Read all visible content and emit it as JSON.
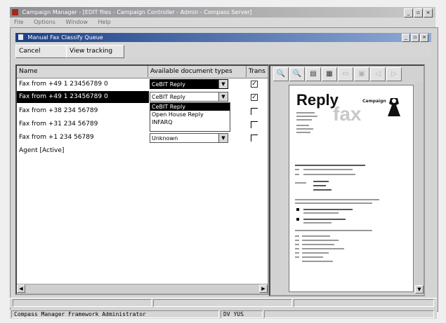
{
  "window": {
    "title": "Campaign Manager - [EDIT files - Campaign Controller - Admin - Compass Server]",
    "buttons": [
      "_",
      "▫",
      "×"
    ]
  },
  "menubar": [
    "File",
    "Options",
    "Window",
    "Help"
  ],
  "child_window": {
    "title": "Manual Fax Classify Queue",
    "buttons": [
      "_",
      "▫",
      "×"
    ]
  },
  "toolbar": {
    "cancel_label": "Cancel",
    "view_log_label": "View tracking"
  },
  "grid": {
    "headers": {
      "name": "Name",
      "types": "Available document types",
      "fr": "Trans"
    },
    "rows": [
      {
        "name": "Fax from +49 1 23456789 0",
        "selected": false
      },
      {
        "name": "Fax from +49 1 23456789 0",
        "selected": true
      },
      {
        "name": "Fax from +38 234 56789",
        "selected": false
      },
      {
        "name": "Fax from +31 234 56789",
        "selected": false
      },
      {
        "name": "Fax from +1 234 56789",
        "selected": false
      },
      {
        "name": "Agent [Active]",
        "selected": false
      }
    ],
    "combos": [
      {
        "value": "CeBIT Reply",
        "selected": true
      },
      {
        "value": "CeBIT Reply",
        "selected": false
      },
      {
        "value": "Unknown",
        "selected": false
      }
    ],
    "dropdown_options": [
      "CeBIT Reply",
      "Open House Reply",
      "INFARQ"
    ],
    "dropdown_selected_index": 0,
    "checks": [
      true,
      true,
      false,
      false,
      false
    ]
  },
  "viewer": {
    "tool_icons": [
      "zoom-in-icon",
      "zoom-out-icon",
      "page-icon",
      "grid-icon",
      "rotate-icon",
      "print-icon",
      "back-icon",
      "forward-icon"
    ],
    "doc_reply": "Reply",
    "doc_fax": "fax",
    "doc_brand": "Campaign"
  },
  "statusbar": {
    "text": "Compass Manager Framework Administrator",
    "mode": "DV YUS"
  }
}
